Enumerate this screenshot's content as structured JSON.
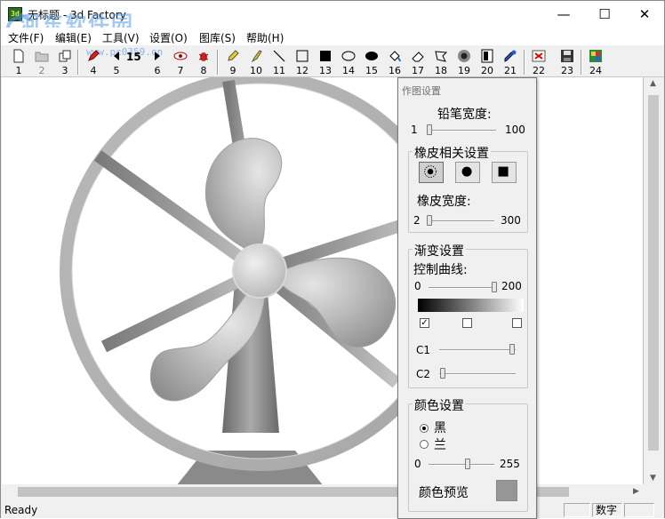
{
  "window": {
    "icon_label": "3d",
    "title": "无标题 - 3d Factory",
    "minimize": "—",
    "maximize": "☐",
    "close": "✕"
  },
  "watermark": {
    "text": "河东软件园",
    "url": "www.pc0359.cn"
  },
  "menu": {
    "items": [
      "文件(F)",
      "编辑(E)",
      "工具(V)",
      "设置(O)",
      "图库(S)",
      "帮助(H)"
    ]
  },
  "toolbar": {
    "buttons": [
      {
        "num": "1",
        "icon": "new-file-icon"
      },
      {
        "num": "2",
        "icon": "open-file-icon"
      },
      {
        "num": "3",
        "icon": "copy-icon"
      },
      {
        "num": "4",
        "icon": "pen-tool-icon"
      },
      {
        "num": "5",
        "icon": "width-down-icon"
      },
      {
        "num": "6",
        "icon": "width-up-icon"
      },
      {
        "num": "7",
        "icon": "eye-icon"
      },
      {
        "num": "8",
        "icon": "bug-icon"
      },
      {
        "num": "9",
        "icon": "pencil-icon"
      },
      {
        "num": "10",
        "icon": "brush-icon"
      },
      {
        "num": "11",
        "icon": "line-icon"
      },
      {
        "num": "12",
        "icon": "rectangle-icon"
      },
      {
        "num": "13",
        "icon": "filled-rectangle-icon"
      },
      {
        "num": "14",
        "icon": "ellipse-icon"
      },
      {
        "num": "15",
        "icon": "filled-ellipse-icon"
      },
      {
        "num": "16",
        "icon": "fill-bucket-icon"
      },
      {
        "num": "17",
        "icon": "eraser-icon"
      },
      {
        "num": "18",
        "icon": "polygon-icon"
      },
      {
        "num": "19",
        "icon": "sphere-icon"
      },
      {
        "num": "20",
        "icon": "gradient-icon"
      },
      {
        "num": "21",
        "icon": "dropper-icon"
      },
      {
        "num": "22",
        "icon": "close-image-icon"
      },
      {
        "num": "23",
        "icon": "save-icon"
      },
      {
        "num": "24",
        "icon": "gallery-icon"
      }
    ],
    "width_value": "15"
  },
  "panel": {
    "title": "作图设置",
    "pencil_width_label": "铅笔宽度:",
    "pencil_min": "1",
    "pencil_max": "100",
    "pencil_value": 5,
    "eraser_group": "橡皮相关设置",
    "eraser_width_label": "橡皮宽度:",
    "eraser_min": "2",
    "eraser_max": "300",
    "eraser_value": 8,
    "gradient_group": "渐变设置",
    "curve_label": "控制曲线:",
    "curve_min": "0",
    "curve_max": "200",
    "curve_value": 200,
    "check1": "✓",
    "c1_label": "C1",
    "c1_value": 0.95,
    "c2_label": "C2",
    "c2_value": 0.05,
    "color_group": "颜色设置",
    "radio_black": "黑",
    "radio_blue": "兰",
    "color_min": "0",
    "color_max": "255",
    "color_value": 150,
    "preview_label": "颜色预览",
    "preview_color": "#969696"
  },
  "status": {
    "text": "Ready",
    "num_pane": "数字"
  }
}
